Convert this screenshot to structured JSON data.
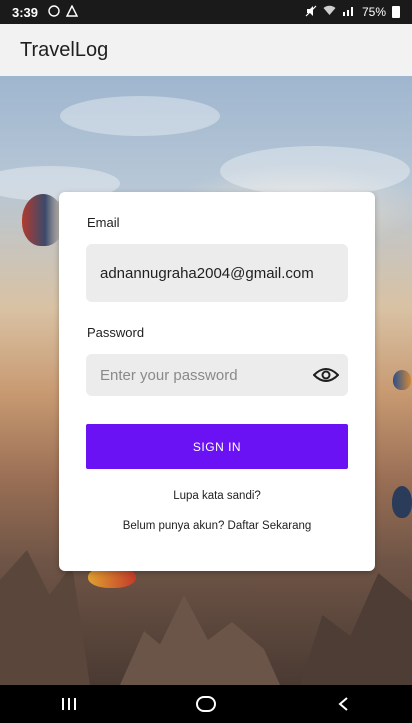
{
  "status_bar": {
    "time": "3:39",
    "battery": "75%"
  },
  "app_bar": {
    "title": "TravelLog"
  },
  "login": {
    "email_label": "Email",
    "email_value": "adnannugraha2004@gmail.com",
    "password_label": "Password",
    "password_placeholder": "Enter your password",
    "sign_in_label": "SIGN IN",
    "forgot_password": "Lupa kata sandi?",
    "register_prompt": "Belum punya akun? Daftar Sekarang"
  },
  "colors": {
    "accent": "#6a12f3",
    "app_bar_bg": "#f2f2f2",
    "field_bg": "#ececec"
  },
  "icons": {
    "password_toggle": "eye-icon",
    "nav_recent": "recent-apps-icon",
    "nav_home": "home-icon",
    "nav_back": "back-icon"
  }
}
